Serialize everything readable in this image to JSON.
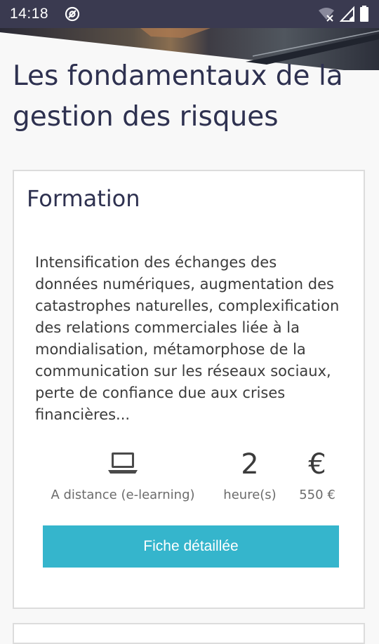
{
  "status_bar": {
    "time": "14:18",
    "left_icon": "at-sign-icon",
    "right_icons": [
      "wifi-off-icon",
      "signal-icon",
      "battery-icon"
    ]
  },
  "page": {
    "title": "Les fondamentaux de la gestion des risques"
  },
  "card": {
    "heading": "Formation",
    "description": "Intensification des échanges des données numériques, augmentation des catastrophes naturelles, complexification des relations commerciales liée à la mondialisation, métamorphose de la communication sur les réseaux sociaux, perte de confiance due aux crises financières...",
    "stats": {
      "mode": {
        "icon": "laptop-icon",
        "label": "A distance (e-learning)"
      },
      "duration": {
        "value": "2",
        "label": "heure(s)"
      },
      "price": {
        "symbol": "€",
        "label": "550 €"
      }
    },
    "button_label": "Fiche détaillée"
  },
  "colors": {
    "status_bar": "#3a3a50",
    "title": "#2e3150",
    "accent_button": "#35b5cc",
    "background": "#f8f8f8"
  }
}
